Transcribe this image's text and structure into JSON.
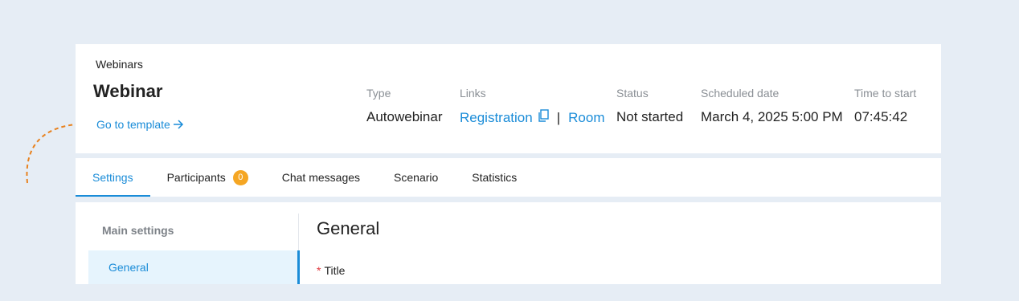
{
  "breadcrumb": "Webinars",
  "title": "Webinar",
  "template_link": "Go to template",
  "meta": {
    "type_label": "Type",
    "type_value": "Autowebinar",
    "links_label": "Links",
    "registration": "Registration",
    "separator": "|",
    "room": "Room",
    "status_label": "Status",
    "status_value": "Not started",
    "date_label": "Scheduled date",
    "date_value": "March 4, 2025 5:00 PM",
    "time_label": "Time to start",
    "time_value": "07:45:42"
  },
  "tabs": [
    {
      "label": "Settings",
      "active": true
    },
    {
      "label": "Participants",
      "badge": "0"
    },
    {
      "label": "Chat messages"
    },
    {
      "label": "Scenario"
    },
    {
      "label": "Statistics"
    }
  ],
  "side_nav": {
    "heading": "Main settings",
    "items": [
      {
        "label": "General",
        "active": true
      }
    ]
  },
  "content": {
    "section_title": "General",
    "required_mark": "*",
    "field_label": "Title"
  },
  "colors": {
    "accent": "#1a8cd8",
    "badge": "#f5a623",
    "required": "#e0383e",
    "arrow": "#e8821f"
  },
  "icons": [
    "arrow-right-icon",
    "copy-icon",
    "dashed-arrow-icon"
  ]
}
